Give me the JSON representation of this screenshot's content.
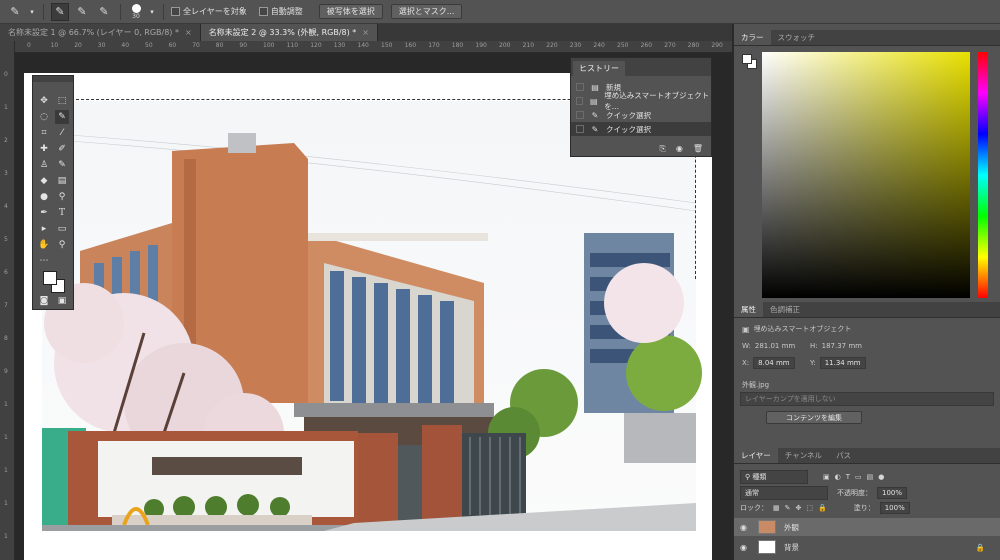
{
  "options_bar": {
    "brush_size": "30",
    "sample_all_layers": "全レイヤーを対象",
    "auto_enhance": "自動調整",
    "select_subject": "被写体を選択",
    "select_and_mask": "選択とマスク..."
  },
  "doc_tabs": [
    {
      "label": "名称未設定 1 @ 66.7% (レイヤー 0, RGB/8) *"
    },
    {
      "label": "名称未設定 2 @ 33.3% (外観, RGB/8) *"
    }
  ],
  "tab_close": "×",
  "ruler_top_marks": [
    "0",
    "10",
    "20",
    "30",
    "40",
    "50",
    "60",
    "70",
    "80",
    "90",
    "100",
    "110",
    "120",
    "130",
    "140",
    "150",
    "160",
    "170",
    "180",
    "190",
    "200",
    "210",
    "220",
    "230",
    "240",
    "250",
    "260",
    "270",
    "280",
    "290"
  ],
  "ruler_left_marks": [
    "0",
    "1",
    "2",
    "3",
    "4",
    "5",
    "6",
    "7",
    "8",
    "9",
    "1",
    "1",
    "1",
    "1",
    "1"
  ],
  "history": {
    "tab": "ヒストリー",
    "items": [
      {
        "label": "新規"
      },
      {
        "label": "埋め込みスマートオブジェクトを..."
      },
      {
        "label": "クイック選択"
      },
      {
        "label": "クイック選択"
      }
    ]
  },
  "color_panel": {
    "tabs": [
      "カラー",
      "スウォッチ"
    ]
  },
  "properties": {
    "tabs": [
      "属性",
      "色調補正"
    ],
    "type": "埋め込みスマートオブジェクト",
    "w_label": "W:",
    "w_value": "281.01 mm",
    "h_label": "H:",
    "h_value": "187.37 mm",
    "x_label": "X:",
    "x_value": "8.04 mm",
    "y_label": "Y:",
    "y_value": "11.34 mm",
    "file": "外観.jpg",
    "comp_placeholder": "レイヤーカンプを適用しない",
    "edit_button": "コンテンツを編集"
  },
  "layers_panel": {
    "tabs": [
      "レイヤー",
      "チャンネル",
      "パス"
    ],
    "filter": "種類",
    "blend_mode": "通常",
    "opacity_label": "不透明度：",
    "opacity": "100%",
    "lock_label": "ロック：",
    "fill_label": "塗り：",
    "fill": "100%",
    "layers": [
      {
        "name": "外観",
        "selected": true
      },
      {
        "name": "背景",
        "selected": false
      }
    ]
  }
}
